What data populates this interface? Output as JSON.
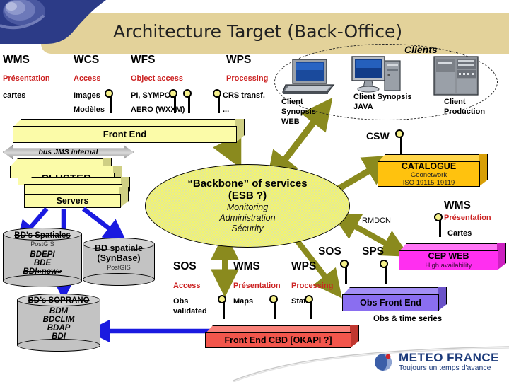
{
  "slide": {
    "title": "Architecture Target (Back-Office)",
    "logo": {
      "name": "METEO FRANCE",
      "tagline": "Toujours un temps d'avance"
    }
  },
  "top_services": [
    {
      "name": "WMS",
      "role": "Présentation",
      "details": [
        "cartes"
      ]
    },
    {
      "name": "WCS",
      "role": "Access",
      "details": [
        "Images",
        "Modèles"
      ]
    },
    {
      "name": "WFS",
      "role": "Object access",
      "details": [
        "PI, SYMPO2",
        "AERO (WXXM)"
      ]
    },
    {
      "name": "WPS",
      "role": "Processing",
      "details": [
        "CRS transf.",
        "..."
      ]
    }
  ],
  "front_end": {
    "label": "Front End"
  },
  "bus": {
    "label": "bus JMS  internal"
  },
  "cluster": {
    "label": "CLUSTER",
    "servers_label": "Servers"
  },
  "databases": [
    {
      "title": "BD’s Spatiales",
      "subtitle": "PostGIS",
      "lines": [
        "BDEPI",
        "BDE",
        "BDI«new»"
      ],
      "struck": "BDI«new»"
    },
    {
      "title": "BD spatiale",
      "title2": "(SynBase)",
      "subtitle": "PostGIS",
      "lines": []
    },
    {
      "title": "BD’s SOPRANO",
      "subtitle": "",
      "lines": [
        "BDM",
        "BDCLIM",
        "BDAP",
        "BDI"
      ]
    }
  ],
  "esb": {
    "line1": "“Backbone” of services",
    "line2": "(ESB ?)",
    "line3": [
      "Monitoring",
      "Administration",
      "Sécurity"
    ]
  },
  "clients": {
    "label": "Clients",
    "items": [
      {
        "name": "Client Synopsis WEB",
        "lines": [
          "Client",
          "Synopsis",
          "WEB"
        ],
        "icon": "laptop-icon"
      },
      {
        "name": "Client Synopsis JAVA",
        "lines": [
          "Client Synopsis",
          "JAVA"
        ],
        "icon": "desktop-tower-icon"
      },
      {
        "name": "Client Production",
        "lines": [
          "Client",
          "Production"
        ],
        "icon": "server-rack-icon"
      }
    ]
  },
  "csw": {
    "label": "CSW"
  },
  "catalogue": {
    "title": "CATALOGUE",
    "sub1": "Geonetwork",
    "sub2": "ISO 19115-19119"
  },
  "rmdcn": {
    "label": "RMDCN"
  },
  "wms_right": {
    "name": "WMS",
    "role": "Présentation",
    "detail": "Cartes"
  },
  "cep_web": {
    "title": "CEP WEB",
    "subtitle": "High availability"
  },
  "obs_front_end": {
    "title": "Obs Front End",
    "caption": "Obs & time series"
  },
  "bottom_services": [
    {
      "name": "SOS",
      "role": "Access",
      "details": [
        "Obs",
        "validated"
      ]
    },
    {
      "name": "WMS",
      "role": "Présentation",
      "details": [
        "Maps"
      ]
    },
    {
      "name": "WPS",
      "role": "Processing",
      "details": [
        "Stats"
      ]
    }
  ],
  "sos_right": {
    "label": "SOS"
  },
  "sps_right": {
    "label": "SPS"
  },
  "front_end_cbd": {
    "label": "Front End CBD [OKAPI ?]"
  },
  "colors": {
    "banner": "#e3d29a",
    "pale_yellow": "#fbfba8",
    "esb_green": "#e2e89a",
    "catalogue_orange": "#ffc20e",
    "cep_magenta": "#ff2ff0",
    "obs_purple": "#8a6ef0",
    "cbd_red": "#f2564c",
    "accent_red_text": "#cc2222",
    "arrow_blue": "#1a1ae0",
    "arrow_olive": "#8a8a1e",
    "logo_blue": "#1b3a7a"
  }
}
